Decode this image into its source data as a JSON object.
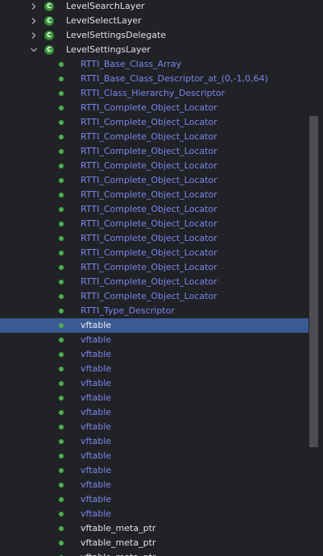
{
  "classes": [
    {
      "label": "LevelSearchLayer",
      "expanded": false,
      "icon": "C"
    },
    {
      "label": "LevelSelectLayer",
      "expanded": false,
      "icon": "C"
    },
    {
      "label": "LevelSettingsDelegate",
      "expanded": false,
      "icon": "C"
    },
    {
      "label": "LevelSettingsLayer",
      "expanded": true,
      "icon": "C"
    }
  ],
  "members": [
    {
      "label": "RTTI_Base_Class_Array",
      "color": "blue"
    },
    {
      "label": "RTTI_Base_Class_Descriptor_at_(0,-1,0,64)",
      "color": "blue"
    },
    {
      "label": "RTTI_Class_Hierarchy_Descriptor",
      "color": "blue"
    },
    {
      "label": "RTTI_Complete_Object_Locator",
      "color": "blue"
    },
    {
      "label": "RTTI_Complete_Object_Locator",
      "color": "blue"
    },
    {
      "label": "RTTI_Complete_Object_Locator",
      "color": "blue"
    },
    {
      "label": "RTTI_Complete_Object_Locator",
      "color": "blue"
    },
    {
      "label": "RTTI_Complete_Object_Locator",
      "color": "blue"
    },
    {
      "label": "RTTI_Complete_Object_Locator",
      "color": "blue"
    },
    {
      "label": "RTTI_Complete_Object_Locator",
      "color": "blue"
    },
    {
      "label": "RTTI_Complete_Object_Locator",
      "color": "blue"
    },
    {
      "label": "RTTI_Complete_Object_Locator",
      "color": "blue"
    },
    {
      "label": "RTTI_Complete_Object_Locator",
      "color": "blue"
    },
    {
      "label": "RTTI_Complete_Object_Locator",
      "color": "blue"
    },
    {
      "label": "RTTI_Complete_Object_Locator",
      "color": "blue"
    },
    {
      "label": "RTTI_Complete_Object_Locator",
      "color": "blue"
    },
    {
      "label": "RTTI_Complete_Object_Locator",
      "color": "blue"
    },
    {
      "label": "RTTI_Type_Descriptor",
      "color": "blue"
    },
    {
      "label": "vftable",
      "color": "blue",
      "selected": true
    },
    {
      "label": "vftable",
      "color": "blue"
    },
    {
      "label": "vftable",
      "color": "blue"
    },
    {
      "label": "vftable",
      "color": "blue"
    },
    {
      "label": "vftable",
      "color": "blue"
    },
    {
      "label": "vftable",
      "color": "blue"
    },
    {
      "label": "vftable",
      "color": "blue"
    },
    {
      "label": "vftable",
      "color": "blue"
    },
    {
      "label": "vftable",
      "color": "blue"
    },
    {
      "label": "vftable",
      "color": "blue"
    },
    {
      "label": "vftable",
      "color": "blue"
    },
    {
      "label": "vftable",
      "color": "blue"
    },
    {
      "label": "vftable",
      "color": "blue"
    },
    {
      "label": "vftable",
      "color": "blue"
    },
    {
      "label": "vftable_meta_ptr",
      "color": "white"
    },
    {
      "label": "vftable_meta_ptr",
      "color": "white"
    },
    {
      "label": "vftable_meta_ptr",
      "color": "white"
    }
  ],
  "colors": {
    "background": "#212226",
    "selection": "#3a5a94",
    "member_blue": "#7a85ec",
    "member_white": "#dfe1e5",
    "dot_green": "#4bb04f",
    "class_icon_green": "#3d9c3f"
  },
  "icons": {
    "collapsed": "chevron-right-icon",
    "expanded": "chevron-down-icon",
    "class": "class-c-icon",
    "member": "member-dot-icon"
  }
}
